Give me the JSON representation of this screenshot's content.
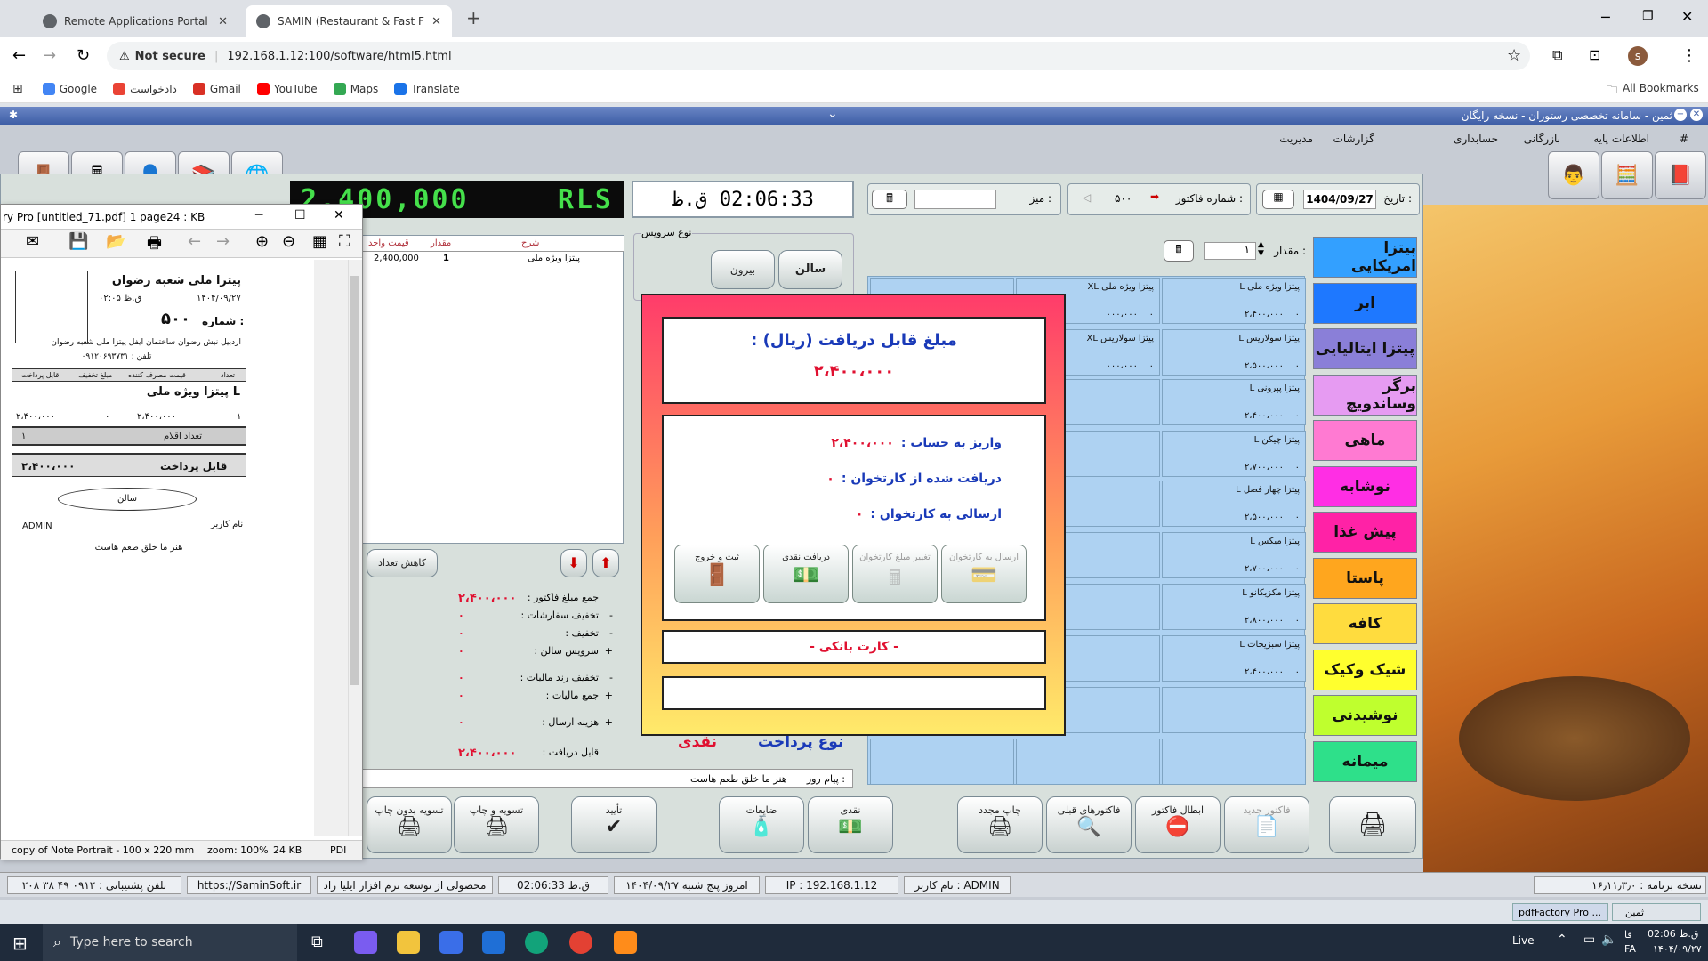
{
  "browser": {
    "tabs": [
      {
        "label": "Remote Applications Portal"
      },
      {
        "label": "SAMIN (Restaurant & Fast Food"
      }
    ],
    "new_tab": "+",
    "not_secure": "Not secure",
    "url": "192.168.1.12:100/software/html5.html",
    "profile_initial": "s",
    "bookmarks": [
      "Google",
      "دادخواست",
      "Gmail",
      "YouTube",
      "Maps",
      "Translate"
    ],
    "all_bookmarks": "All Bookmarks"
  },
  "app": {
    "title": "ثمین - سامانه تخصصی رستوران - نسخه رایگان",
    "menu": [
      "#",
      "اطلاعات پایه",
      "بازرگانی",
      "حسابداری",
      "گزارشات",
      "مدیریت"
    ],
    "led": "2,400,000",
    "led_unit": "RLS",
    "clock_time": "02:06:33",
    "clock_ampm": "ق.ظ",
    "table_label": "میز :",
    "invoice_label": "شماره فاکتور :",
    "invoice_no": "۵۰۰",
    "date_label": "تاریخ :",
    "date": "1404/09/27",
    "service_type_label": "نوع سرویس",
    "service_hall": "سالن",
    "service_out": "بیرون",
    "qty_label": "مقدار :",
    "qty": "۱",
    "order_headers": [
      "شرح",
      "مقدار",
      "قیمت واحد"
    ],
    "order_rows": [
      {
        "desc": "پیتزا ویژه ملی",
        "qty": "1",
        "price": "2,400,000"
      }
    ],
    "reduce_qty": "کاهش تعداد",
    "totals": [
      {
        "label": "جمع مبلغ فاکتور :",
        "value": "۲،۴۰۰،۰۰۰",
        "sign": ""
      },
      {
        "label": "تخفیف سفارشات :",
        "value": "۰",
        "sign": "-"
      },
      {
        "label": "تخفیف :",
        "value": "۰",
        "sign": "-"
      },
      {
        "label": "سرویس سالن :",
        "value": "۰",
        "sign": "+"
      },
      {
        "label": "تخفیف رند مالیات :",
        "value": "۰",
        "sign": "-"
      },
      {
        "label": "جمع مالیات :",
        "value": "۰",
        "sign": "+"
      },
      {
        "label": "هزینه ارسال :",
        "value": "۰",
        "sign": "+"
      },
      {
        "label": "قابل دریافت :",
        "value": "۲،۴۰۰،۰۰۰",
        "sign": ""
      }
    ],
    "payment_type_label": "نوع پرداخت",
    "payment_type": "نقدی",
    "daily_msg_label": "پیام روز :",
    "daily_msg": "هنر ما خلق طعم هاست",
    "categories": [
      {
        "label": "پیتزا امریکایی",
        "color": "#33a0ff"
      },
      {
        "label": "ابر",
        "color": "#1e78ff"
      },
      {
        "label": "پیتزا ایتالیایی",
        "color": "#8a7fd8"
      },
      {
        "label": "برگر وساندویچ",
        "color": "#e69bf2"
      },
      {
        "label": "ماهی",
        "color": "#ff7ad2"
      },
      {
        "label": "نوشابه",
        "color": "#ff2ee4"
      },
      {
        "label": "پیش غذا",
        "color": "#ff22a6"
      },
      {
        "label": "پاستا",
        "color": "#ffa61e"
      },
      {
        "label": "کافه",
        "color": "#ffdc3e"
      },
      {
        "label": "شیک وکیک",
        "color": "#ffff2e"
      },
      {
        "label": "نوشیدنی",
        "color": "#bfff2e"
      },
      {
        "label": "میمانه",
        "color": "#2ee08a"
      }
    ],
    "items": [
      {
        "name": "پیتزا ویژه ملی L",
        "price": "۲،۴۰۰،۰۰۰"
      },
      {
        "name": "پیتزا ویژه ملی XL",
        "price": "۰۰۰،۰۰۰"
      },
      {
        "name": "پیتزا سولاریس L",
        "price": "۲،۵۰۰،۰۰۰"
      },
      {
        "name": "پیتزا سولاریس XL",
        "price": "۰۰۰،۰۰۰"
      },
      {
        "name": "پیتزا پپرونی L",
        "price": "۲،۴۰۰،۰۰۰"
      },
      {
        "name": "پیتزا چیکن L",
        "price": "۲،۷۰۰،۰۰۰"
      },
      {
        "name": "پیتزا چهار فصل L",
        "price": "۲،۵۰۰،۰۰۰"
      },
      {
        "name": "پیتزا میکس L",
        "price": "۲،۷۰۰،۰۰۰"
      },
      {
        "name": "پیتزا مکزیکانو L",
        "price": "۲،۸۰۰،۰۰۰"
      },
      {
        "name": "پیتزا سبزیجات L",
        "price": "۲،۴۰۰،۰۰۰"
      }
    ],
    "bottom_buttons": [
      "تسویه بدون چاپ",
      "تسویه و چاپ",
      "تأیید",
      "ضایعات",
      "نقدی",
      "چاپ مجدد",
      "فاکتورهای قبلی",
      "ابطال فاکتور",
      "فاکتور جدید"
    ]
  },
  "modal": {
    "title": "مبلغ قابل دریافت (ریال) :",
    "amount": "۲،۴۰۰،۰۰۰",
    "deposit_label": "واریز به حساب :",
    "deposit_value": "۲،۴۰۰،۰۰۰",
    "received_label": "دریافت شده از کارتخوان :",
    "received_value": "۰",
    "sent_label": "ارسالی به کارتخوان :",
    "sent_value": "۰",
    "buttons": [
      "ارسال به کارتخوان",
      "تغییر مبلغ کارتخوان",
      "دریافت نقدی",
      "ثبت و خروج"
    ],
    "card_text": "- کارت بانکی -"
  },
  "pdf": {
    "title": "ry Pro [untitled_71.pdf] 1 page24 : KB",
    "shop_name": "پیتزا ملی شعبه رضوان",
    "date": "۱۴۰۴/۰۹/۲۷",
    "time": "ق.ظ ۰۲:۰۵",
    "number_label": "شماره :",
    "number": "۵۰۰",
    "address": "اردبیل  نبش رضوان  ساختمان ایفل  پیتزا ملی شعبه رضوان",
    "phone": "تلفن : ۰۹۱۲۰۶۹۳۷۳۱",
    "col_headers": [
      "تعداد",
      "قیمت مصرف کننده",
      "مبلغ تخفیف",
      "قابل پرداخت"
    ],
    "item_name": "پیتزا ویژه ملی L",
    "item_qty": "۱",
    "item_price": "۲،۴۰۰،۰۰۰",
    "item_discount": "۰",
    "item_total": "۲،۴۰۰،۰۰۰",
    "count_label": "تعداد اقلام",
    "count": "۱",
    "payable_label": "قابل پرداخت",
    "payable": "۲،۴۰۰،۰۰۰",
    "hall": "سالن",
    "user_label": "نام کاربر",
    "user": "ADMIN",
    "footer_msg": "هنر ما خلق طعم هاست",
    "status_desc": "copy of Note Portrait - 100 x 220 mm",
    "status_zoom": "zoom: 100%",
    "status_size": "24 KB",
    "status_type": "PDI"
  },
  "status": {
    "version": "نسخه برنامه : ۱۶٫۱۱٫۳٫۰",
    "user": "نام کاربر : ADMIN",
    "ip": "IP : 192.168.1.12",
    "today": "امروز پنج شنبه   ۱۴۰۴/۰۹/۲۷",
    "time": "ق.ظ 02:06:33",
    "product": "محصولی از توسعه نرم افزار ایلیا راد",
    "site": "https://SaminSoft.ir",
    "support": "تلفن پشتیبانی : ۰۹۱۲ ۴۹ ۳۸ ۲۰۸"
  },
  "taskbar": {
    "search_placeholder": "Type here to search",
    "live": "Live",
    "lang": "FA",
    "time": "ق.ظ 02:06",
    "date": "۱۴۰۴/۰۹/۲۷",
    "lang_top": "فا",
    "pdf_task": "pdfFactory Pro ...",
    "samin_task": "ثمین"
  }
}
